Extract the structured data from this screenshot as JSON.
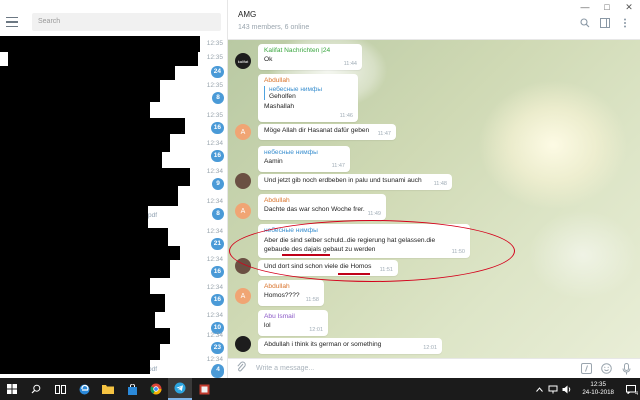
{
  "window": {
    "controls": [
      "minimize",
      "maximize",
      "close"
    ]
  },
  "sidebar": {
    "search_placeholder": "Search",
    "chats": [
      {
        "time": "12:35",
        "badge": ""
      },
      {
        "time": "12:35",
        "badge": "24"
      },
      {
        "time": "12:35",
        "badge": "8"
      },
      {
        "time": "12:35",
        "badge": "16"
      },
      {
        "time": "12:34",
        "badge": "16"
      },
      {
        "time": "12:34",
        "badge": "9"
      },
      {
        "time": "12:34",
        "badge": "8"
      },
      {
        "time": "12:34",
        "badge": "21"
      },
      {
        "time": "12:34",
        "badge": "16"
      },
      {
        "time": "12:34",
        "badge": "16"
      },
      {
        "time": "12:34",
        "badge": "10"
      },
      {
        "time": "12:34",
        "badge": "23"
      },
      {
        "time": "12:34",
        "badge": "16"
      },
      {
        "time": "",
        "badge": "4"
      }
    ],
    "fragments": [
      "pdf",
      "pdf",
      "pdf"
    ]
  },
  "chat": {
    "title": "AMG",
    "subtitle": "143 members, 6 online",
    "input_placeholder": "Write a message...",
    "messages": [
      {
        "sender": "Kalifat Nachrichten |24",
        "text": "Ok",
        "time": "11:44"
      },
      {
        "sender": "Abdullah",
        "reply_name": "небесные нимфы",
        "reply_text": "Geholfen",
        "text": "Mashallah",
        "time": "11:46"
      },
      {
        "sender": "",
        "text": "Möge Allah dir Hasanat dafür geben",
        "time": "11:47"
      },
      {
        "sender": "небесные нимфы",
        "text": "Aamin",
        "time": "11:47"
      },
      {
        "sender": "",
        "text": "Und jetzt gib noch erdbeben in palu und tsunami auch",
        "time": "11:48"
      },
      {
        "sender": "Abdullah",
        "text": "Dachte das war schon Woche frer.",
        "time": "11:49"
      },
      {
        "sender": "небесные нимфы",
        "text": "Aber die sind selber schuld..die regierung hat gelassen.die gebaude des dajals gebaut zu werden",
        "time": "11:50"
      },
      {
        "sender": "",
        "text": "Und dort sind schon viele die Homos",
        "time": "11:51"
      },
      {
        "sender": "Abdullah",
        "text": "Homos????",
        "time": "11:58"
      },
      {
        "sender": "Abu Ismail",
        "text": "lol",
        "time": "12:01"
      },
      {
        "sender": "",
        "text": "Abdullah i think its german or something",
        "time": "12:01"
      }
    ],
    "avatar_letter": "A",
    "avatar_logo_text": "kalifat"
  },
  "taskbar": {
    "time": "12:35",
    "date": "24-10-2018",
    "notification_count": "4"
  },
  "colors": {
    "accent": "#4a9ad7",
    "sender_green": "#3aa63f",
    "sender_orange": "#d9732b",
    "sender_blue": "#3a8fcf",
    "sender_purple": "#8b58c7",
    "annotation_red": "#d4001b"
  }
}
